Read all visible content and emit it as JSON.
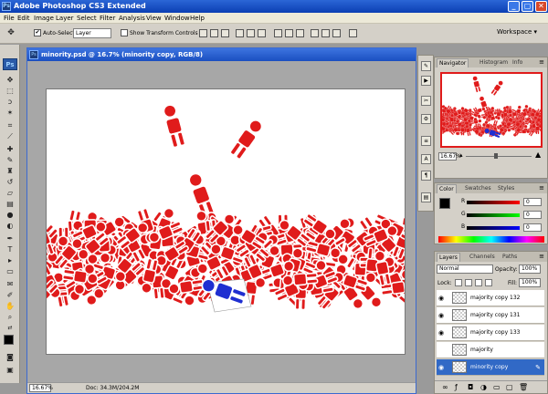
{
  "window": {
    "title": "Adobe Photoshop CS3 Extended",
    "app_icon_label": "Ps"
  },
  "window_controls": {
    "minimize": "_",
    "maximize": "▢",
    "close": "✕"
  },
  "menu": [
    "File",
    "Edit",
    "Image",
    "Layer",
    "Select",
    "Filter",
    "Analysis",
    "View",
    "Window",
    "Help"
  ],
  "options": {
    "auto_select_label": "Auto-Select:",
    "auto_select_checked": "✔",
    "auto_select_value": "Layer",
    "show_transform_label": "Show Transform Controls",
    "workspace_label": "Workspace ▾"
  },
  "toolbox": {
    "logo": "Ps"
  },
  "document": {
    "title": "minority.psd @ 16.7% (minority copy, RGB/8)",
    "zoom": "16.67%",
    "doc_info": "Doc: 34.3M/204.2M"
  },
  "navigator": {
    "tabs": [
      "Navigator",
      "Histogram",
      "Info"
    ],
    "zoom": "16.67%"
  },
  "color_panel": {
    "tabs": [
      "Color",
      "Swatches",
      "Styles"
    ],
    "channels": [
      {
        "label": "R",
        "value": "0"
      },
      {
        "label": "G",
        "value": "0"
      },
      {
        "label": "B",
        "value": "0"
      }
    ]
  },
  "layers_panel": {
    "tabs": [
      "Layers",
      "Channels",
      "Paths"
    ],
    "blend_mode": "Normal",
    "opacity_label": "Opacity:",
    "opacity_value": "100%",
    "lock_label": "Lock:",
    "fill_label": "Fill:",
    "fill_value": "100%",
    "layers": [
      {
        "name": "majority copy 132",
        "visible": true,
        "selected": false
      },
      {
        "name": "majority copy 131",
        "visible": true,
        "selected": false
      },
      {
        "name": "majority copy 133",
        "visible": true,
        "selected": false
      },
      {
        "name": "majority",
        "visible": false,
        "selected": false
      },
      {
        "name": "minority copy",
        "visible": true,
        "selected": true
      }
    ]
  },
  "colors": {
    "accent_red": "#e01b1b",
    "minority_blue": "#1f2fd1",
    "titlebar_blue": "#1a4fc0"
  }
}
